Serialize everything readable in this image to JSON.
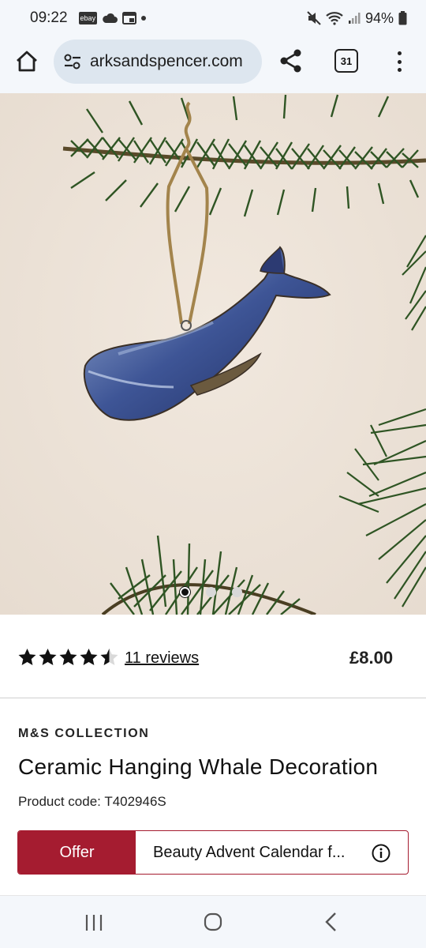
{
  "status_bar": {
    "time": "09:22",
    "ebay_badge": "ebay",
    "battery": "94%",
    "icons": [
      "ebay-icon",
      "cloud-icon",
      "calendar-icon",
      "dot-icon",
      "mute-icon",
      "wifi-icon",
      "signal-icon",
      "battery-icon"
    ]
  },
  "browser": {
    "url": "arksandspencer.com",
    "tab_count": "31",
    "icons": [
      "home-icon",
      "site-settings-icon",
      "share-icon",
      "tabs-icon",
      "more-menu-icon"
    ]
  },
  "carousel": {
    "total_images": 3,
    "active_index": 0
  },
  "product": {
    "rating": 4.5,
    "rating_max": 5,
    "reviews_label": "11 reviews",
    "price": "£8.00",
    "brand": "M&S COLLECTION",
    "title": "Ceramic Hanging Whale Decoration",
    "product_code": "Product code: T402946S"
  },
  "offer": {
    "label": "Offer",
    "text": "Beauty Advent Calendar f...",
    "accent_color": "#a51c30"
  },
  "nav_bar": {
    "icons": [
      "recent-apps-icon",
      "home-circle-icon",
      "back-icon"
    ]
  }
}
